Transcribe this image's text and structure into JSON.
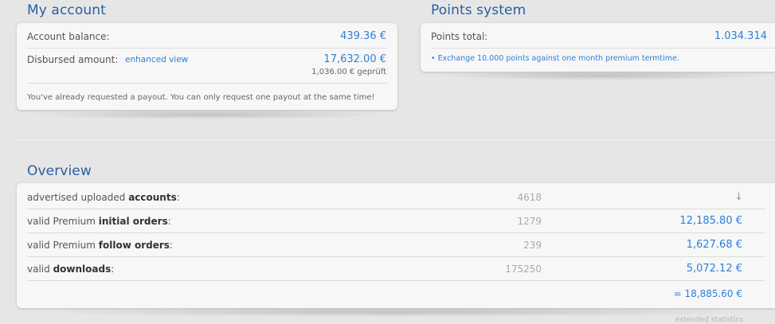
{
  "account": {
    "title": "My account",
    "balance_label": "Account balance:",
    "balance_value": "439.36 €",
    "disbursed_label": "Disbursed amount:",
    "enhanced_view_link": "enhanced view",
    "disbursed_value": "17,632.00 €",
    "disbursed_checked": "1,036.00 € geprüft",
    "notice": "You've already requested a payout. You can only request one payout at the same time!"
  },
  "points": {
    "title": "Points system",
    "total_label": "Points total:",
    "total_value": "1.034.314",
    "exchange_link": "• Exchange 10.000 points against one month premium termtime."
  },
  "overview": {
    "title": "Overview",
    "rows": [
      {
        "prefix": "advertised uploaded ",
        "bold": "accounts",
        "suffix": ":",
        "count": "4618",
        "amount": "↓"
      },
      {
        "prefix": "valid Premium ",
        "bold": "initial orders",
        "suffix": ":",
        "count": "1279",
        "amount": "12,185.80 €"
      },
      {
        "prefix": "valid Premium ",
        "bold": "follow orders",
        "suffix": ":",
        "count": "239",
        "amount": "1,627.68 €"
      },
      {
        "prefix": "valid ",
        "bold": "downloads",
        "suffix": ":",
        "count": "175250",
        "amount": "5,072.12 €"
      }
    ],
    "total": "= 18,885.60 €",
    "extended_link": "extended statistics"
  },
  "colors": {
    "accent": "#2f7fd6",
    "heading": "#2a5fa0",
    "background": "#e6e6e6"
  }
}
